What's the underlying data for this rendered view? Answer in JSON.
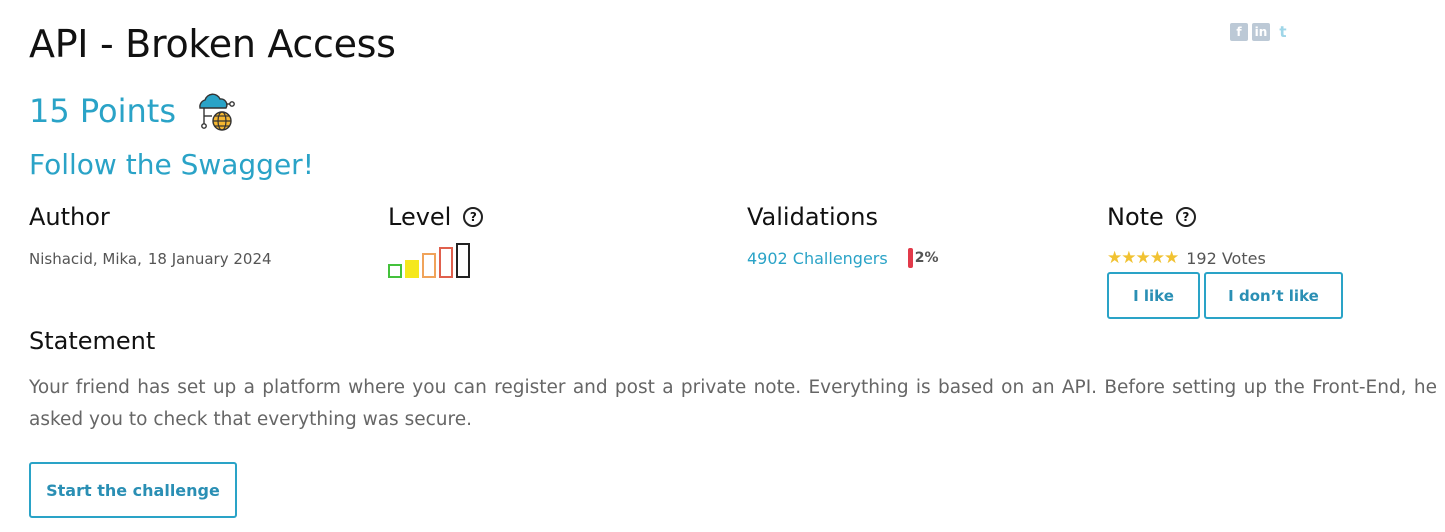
{
  "challenge": {
    "title": "API - Broken Access",
    "points": "15 Points",
    "category_icon": "cloud-network-globe-icon",
    "subtitle": "Follow the Swagger!"
  },
  "social": [
    {
      "name": "facebook-icon",
      "glyph": "f"
    },
    {
      "name": "linkedin-icon",
      "glyph": "in"
    },
    {
      "name": "twitter-icon",
      "glyph": "t"
    }
  ],
  "author": {
    "heading": "Author",
    "names": "Nishacid, Mika,",
    "date": "18 January 2024"
  },
  "level": {
    "heading": "Level",
    "help": "?",
    "value": 2,
    "max": 5,
    "colors": [
      "#44c13c",
      "#f5e81c",
      "#f0a35a",
      "#e0604d",
      "#222222"
    ]
  },
  "validations": {
    "heading": "Validations",
    "challengers": "4902 Challengers",
    "percent": "2%",
    "bar_color": "#e23a4a"
  },
  "note": {
    "heading": "Note",
    "help": "?",
    "stars": "★★★★★",
    "rating": 5,
    "votes": "192 Votes",
    "like_label": "I like",
    "dislike_label": "I don’t like"
  },
  "statement": {
    "heading": "Statement",
    "text": "Your friend has set up a platform where you can register and post a private note. Everything is based on an API. Before setting up the Front-End, he asked you to check that everything was secure."
  },
  "start_label": "Start the challenge",
  "colors": {
    "accent": "#2aa3c7",
    "star": "#f1c232"
  }
}
